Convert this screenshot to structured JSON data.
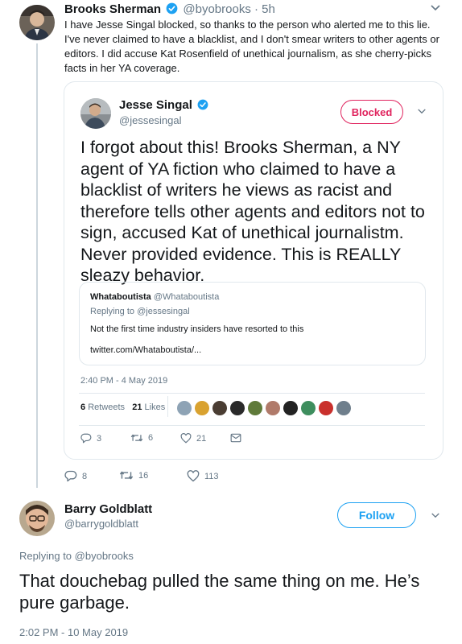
{
  "top_tweet": {
    "name": "Brooks Sherman",
    "handle": "@byobrooks",
    "dot": "·",
    "time": "5h",
    "text": "I have Jesse Singal blocked, so thanks to the person who alerted me to this lie. I've never claimed to have a blacklist, and I don't smear writers to other agents or editors. I did accuse Kat Rosenfield of unethical journalism, as she cherry-picks facts in her YA coverage.",
    "actions": {
      "replies": "8",
      "retweets": "16",
      "likes": "113"
    }
  },
  "quoted_tweet": {
    "name": "Jesse Singal",
    "handle": "@jessesingal",
    "blocked_label": "Blocked",
    "text": "I forgot about this! Brooks Sherman, a NY agent of YA fiction who claimed to have a blacklist of writers he views as racist and therefore tells other agents and editors not to sign, accused Kat of unethical journalistm. Never provided evidence. This is REALLY sleazy behavior.",
    "inner_quote": {
      "name": "Whataboutista",
      "handle": "@Whataboutista",
      "replying": "Replying to @jessesingal",
      "text": "Not the first time industry insiders have resorted to this",
      "link": "twitter.com/Whataboutista/..."
    },
    "timestamp": "2:40 PM - 4 May 2019",
    "retweets_count": "6",
    "retweets_label": "Retweets",
    "likes_count": "21",
    "likes_label": "Likes",
    "actions": {
      "replies": "3",
      "retweets": "6",
      "likes": "21"
    }
  },
  "reply_tweet": {
    "name": "Barry Goldblatt",
    "handle": "@barrygoldblatt",
    "follow_label": "Follow",
    "replying_prefix": "Replying to",
    "replying_handle": "@byobrooks",
    "text": "That douchebag pulled the same thing on me. He’s pure garbage.",
    "timestamp": "2:02 PM - 10 May 2019"
  },
  "colors": {
    "verified": "#1da1f2",
    "blocked": "#e0245e",
    "follow": "#1da1f2",
    "muted": "#657786",
    "border": "#e1e8ed"
  },
  "icons": [
    "verified-badge-icon",
    "chevron-down-icon",
    "reply-icon",
    "retweet-icon",
    "like-icon",
    "direct-message-icon"
  ]
}
